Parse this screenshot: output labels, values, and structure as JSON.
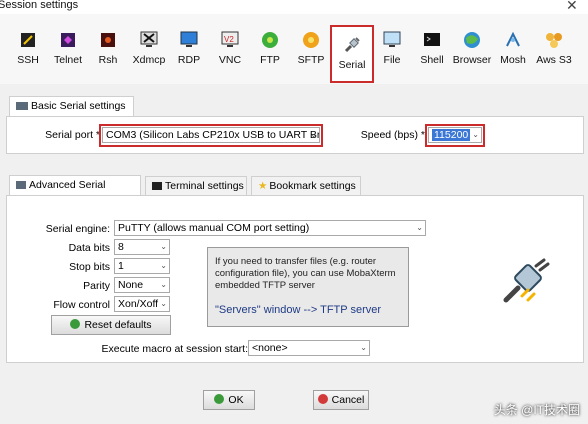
{
  "window": {
    "title": "Session settings"
  },
  "toolbar": {
    "items": [
      {
        "label": "SSH",
        "icon": "ssh-icon"
      },
      {
        "label": "Telnet",
        "icon": "telnet-icon"
      },
      {
        "label": "Rsh",
        "icon": "rsh-icon"
      },
      {
        "label": "Xdmcp",
        "icon": "xdmcp-icon"
      },
      {
        "label": "RDP",
        "icon": "rdp-icon"
      },
      {
        "label": "VNC",
        "icon": "vnc-icon"
      },
      {
        "label": "FTP",
        "icon": "ftp-icon"
      },
      {
        "label": "SFTP",
        "icon": "sftp-icon"
      },
      {
        "label": "Serial",
        "icon": "serial-plug-icon",
        "selected": true
      },
      {
        "label": "File",
        "icon": "file-icon"
      },
      {
        "label": "Shell",
        "icon": "shell-icon"
      },
      {
        "label": "Browser",
        "icon": "browser-icon"
      },
      {
        "label": "Mosh",
        "icon": "mosh-icon"
      },
      {
        "label": "Aws S3",
        "icon": "aws-s3-icon"
      }
    ]
  },
  "basic": {
    "tab_label": "Basic Serial settings",
    "serial_port_label": "Serial port *",
    "serial_port_value": "COM3  (Silicon Labs CP210x USB to UART Br",
    "speed_label": "Speed (bps) *",
    "speed_value": "115200"
  },
  "advanced": {
    "tabs": [
      {
        "label": "Advanced Serial settings",
        "active": true
      },
      {
        "label": "Terminal settings",
        "active": false
      },
      {
        "label": "Bookmark settings",
        "active": false
      }
    ],
    "serial_engine_label": "Serial engine:",
    "serial_engine_value": "PuTTY   (allows manual COM port setting)",
    "data_bits_label": "Data bits",
    "data_bits_value": "8",
    "stop_bits_label": "Stop bits",
    "stop_bits_value": "1",
    "parity_label": "Parity",
    "parity_value": "None",
    "flow_control_label": "Flow control",
    "flow_control_value": "Xon/Xoff",
    "reset_label": "Reset defaults",
    "info_line1": "If you need to transfer files (e.g. router",
    "info_line2": "configuration file), you can use MobaXterm",
    "info_line3": "embedded TFTP server",
    "info_link": "\"Servers\" window  -->  TFTP server",
    "macro_label": "Execute macro at session start:",
    "macro_value": "<none>"
  },
  "footer": {
    "ok_label": "OK",
    "cancel_label": "Cancel"
  },
  "watermark": "头条 @IT技术圈",
  "colors": {
    "highlight": "#cc2b2b",
    "selection": "#3b78d6"
  }
}
